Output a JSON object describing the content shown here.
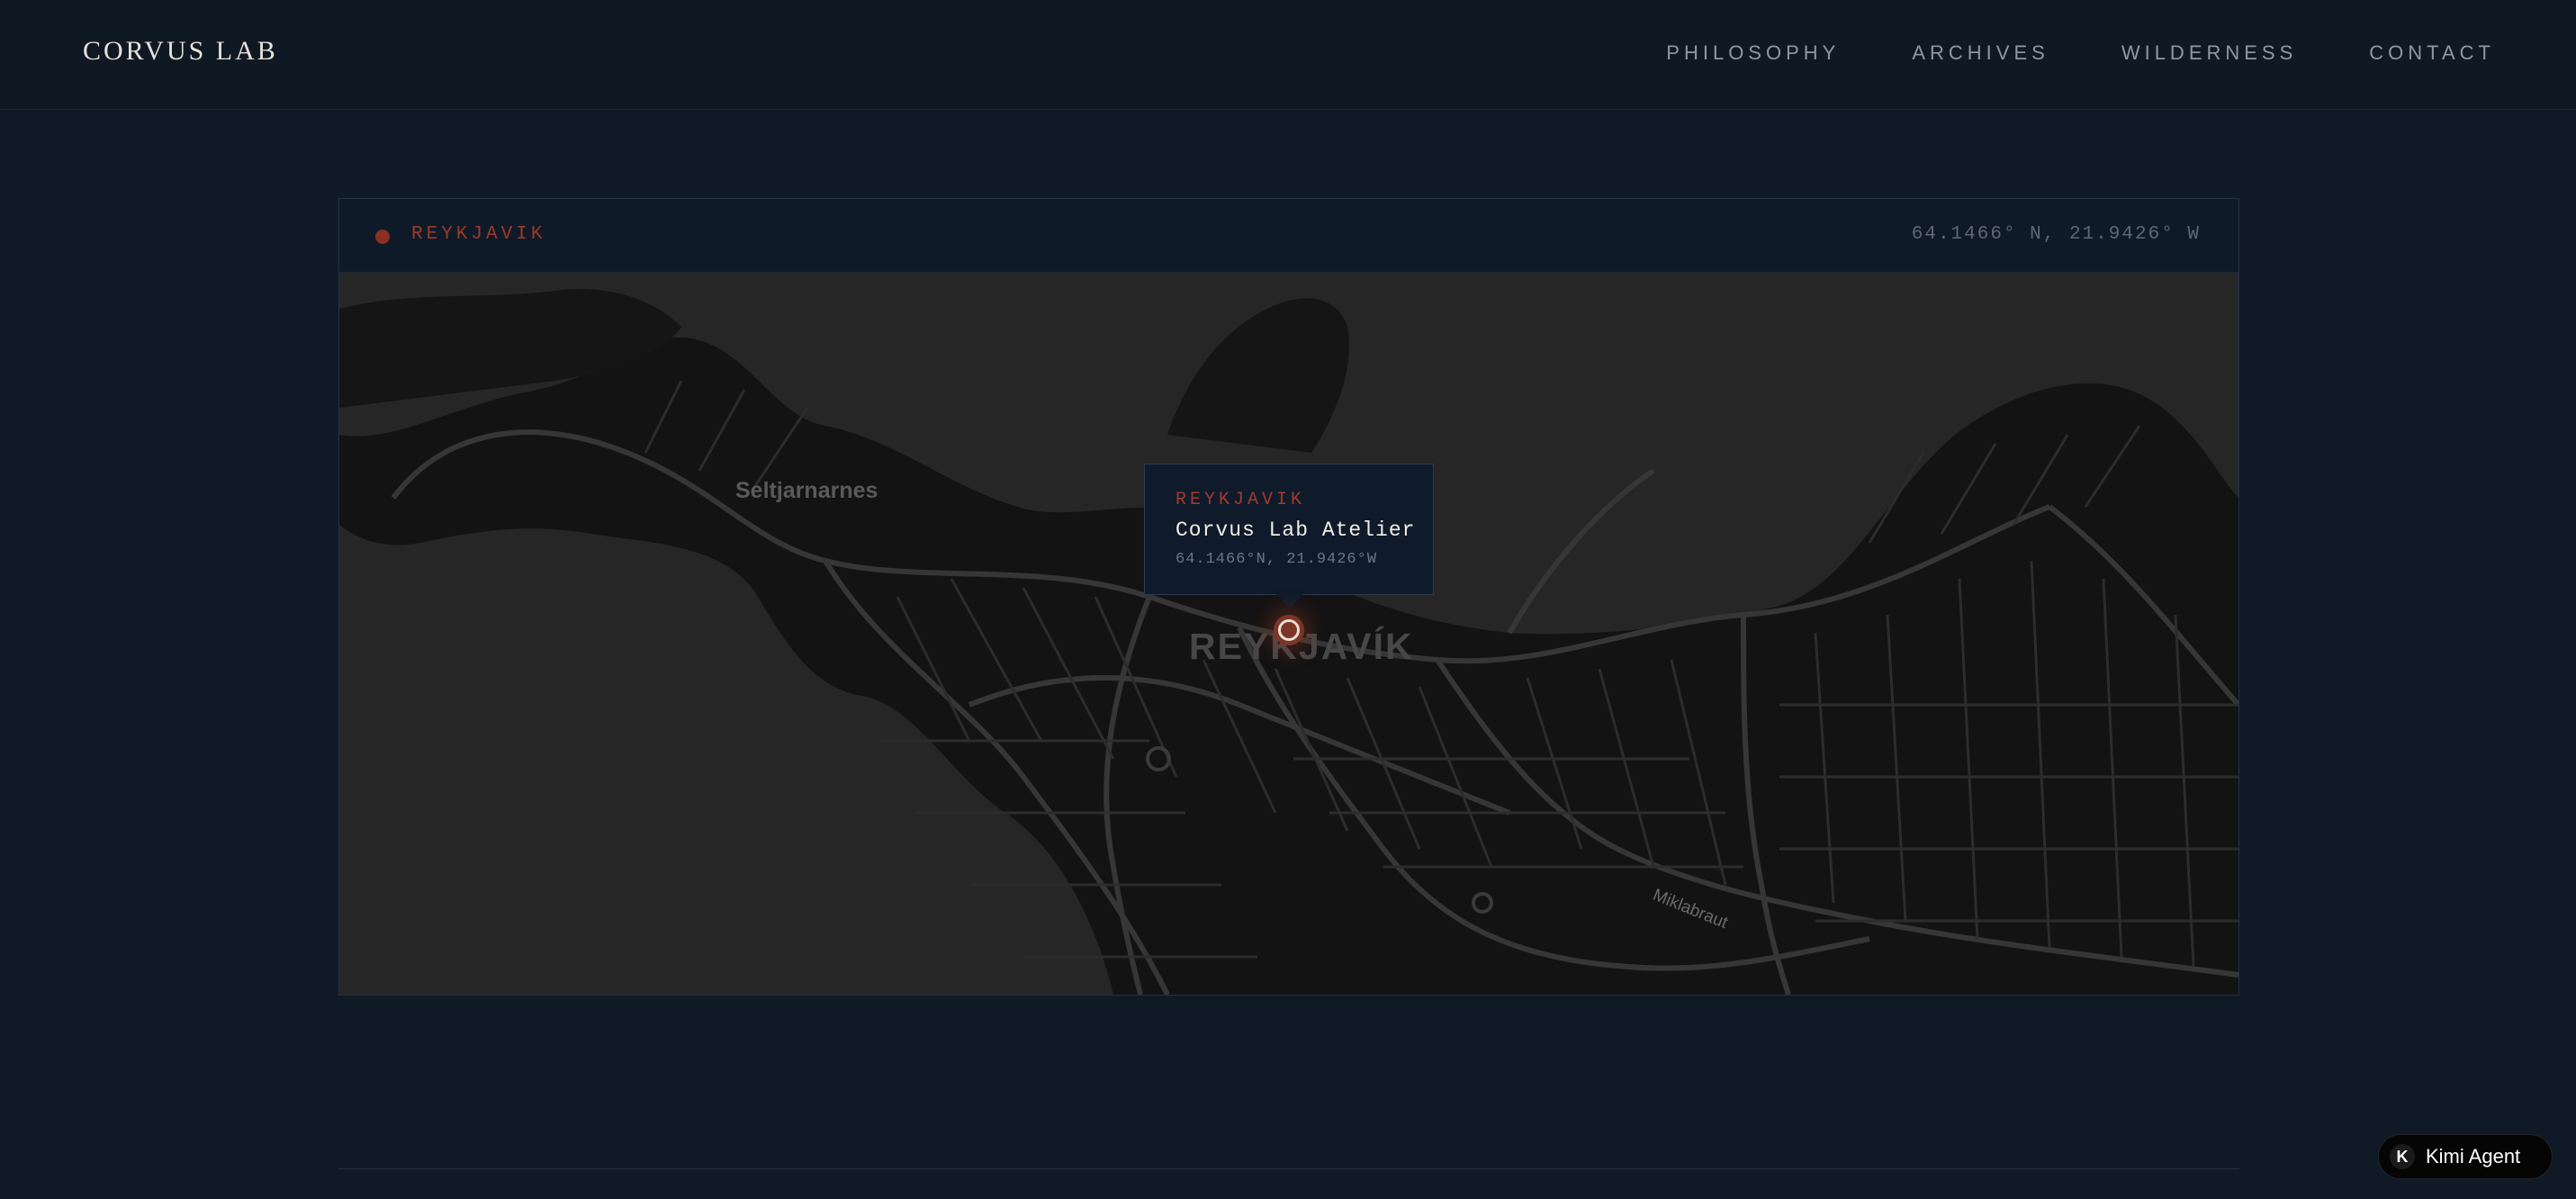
{
  "brand": "CORVUS LAB",
  "nav": {
    "items": [
      {
        "label": "PHILOSOPHY"
      },
      {
        "label": "ARCHIVES"
      },
      {
        "label": "WILDERNESS"
      },
      {
        "label": "CONTACT"
      }
    ]
  },
  "map_card": {
    "location": "REYKJAVIK",
    "coordinates": "64.1466° N, 21.9426° W",
    "popup": {
      "city": "REYKJAVIK",
      "name": "Corvus Lab Atelier",
      "coordinates": "64.1466°N, 21.9426°W"
    },
    "map_labels": {
      "district": "Seltjarnarnes",
      "city": "REYKJAVÍK",
      "road": "Miklabraut"
    }
  },
  "agent_badge": {
    "icon": "K",
    "label": "Kimi Agent"
  },
  "colors": {
    "background": "#101a27",
    "accent": "#9a3a2b",
    "water": "#262626",
    "land": "#121212",
    "roads": "#3a3a3a"
  }
}
